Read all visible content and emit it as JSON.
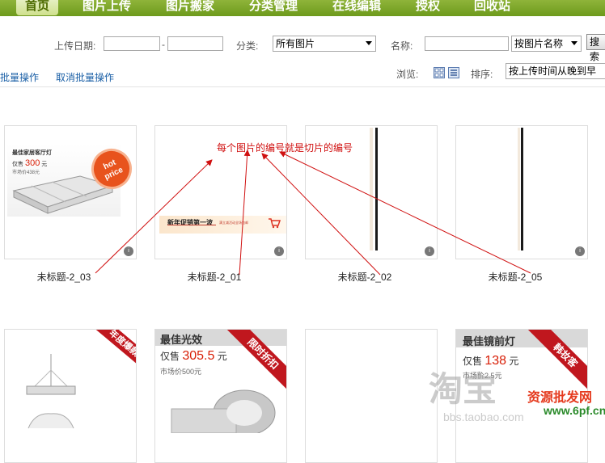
{
  "nav": {
    "items": [
      {
        "label": "首页",
        "active": true
      },
      {
        "label": "图片上传"
      },
      {
        "label": "图片搬家"
      },
      {
        "label": "分类管理"
      },
      {
        "label": "在线编辑"
      },
      {
        "label": "授权"
      },
      {
        "label": "回收站"
      }
    ]
  },
  "filters": {
    "upload_date_label": "上传日期:",
    "date_separator": "-",
    "category_label": "分类:",
    "category_value": "所有图片",
    "name_label": "名称:",
    "name_field_value": "按图片名称",
    "search_label": "搜索"
  },
  "toolbar": {
    "batch_label": "批量操作",
    "cancel_batch_label": "取消批量操作",
    "browse_label": "浏览:",
    "sort_label": "排序:",
    "sort_value": "按上传时间从晚到早"
  },
  "annotation": {
    "note": "每个图片的编号就是切片的编号"
  },
  "cards": [
    {
      "caption": "未标题-2_03",
      "thumb": {
        "title": "最佳家居客厅灯",
        "price_prefix": "仅售",
        "price": "300",
        "unit": "元",
        "market": "市场价438元",
        "badge_line1": "hot",
        "badge_line2": "price"
      }
    },
    {
      "caption": "未标题-2_01",
      "thumb": {
        "banner": "新年促销第一波",
        "small": "满立减活动全场包邮"
      }
    },
    {
      "caption": "未标题-2_02",
      "thumb": {}
    },
    {
      "caption": "未标题-2_05",
      "thumb": {}
    },
    {
      "caption": "",
      "thumb": {
        "ribbon": "年度爆款"
      }
    },
    {
      "caption": "",
      "thumb": {
        "title": "最佳光效",
        "price_prefix": "仅售",
        "price": "305.5",
        "unit": "元",
        "market": "市场价500元",
        "ribbon": "限时折扣"
      }
    },
    {
      "caption": "",
      "thumb": {}
    },
    {
      "caption": "",
      "thumb": {
        "title": "最佳镜前灯",
        "price_prefix": "仅售",
        "price": "138",
        "unit": "元",
        "market": "市场价2.5元",
        "ribbon": "韩妆客"
      }
    }
  ],
  "watermark": {
    "big": "淘宝",
    "url": "bbs.taobao.com",
    "logo": "资源批发网",
    "logo_url": "www.6pf.cn"
  },
  "colors": {
    "nav_green": "#7aa528",
    "link_blue": "#1a5fa6",
    "annotation_red": "#d01010",
    "price_red": "#d81e06"
  }
}
